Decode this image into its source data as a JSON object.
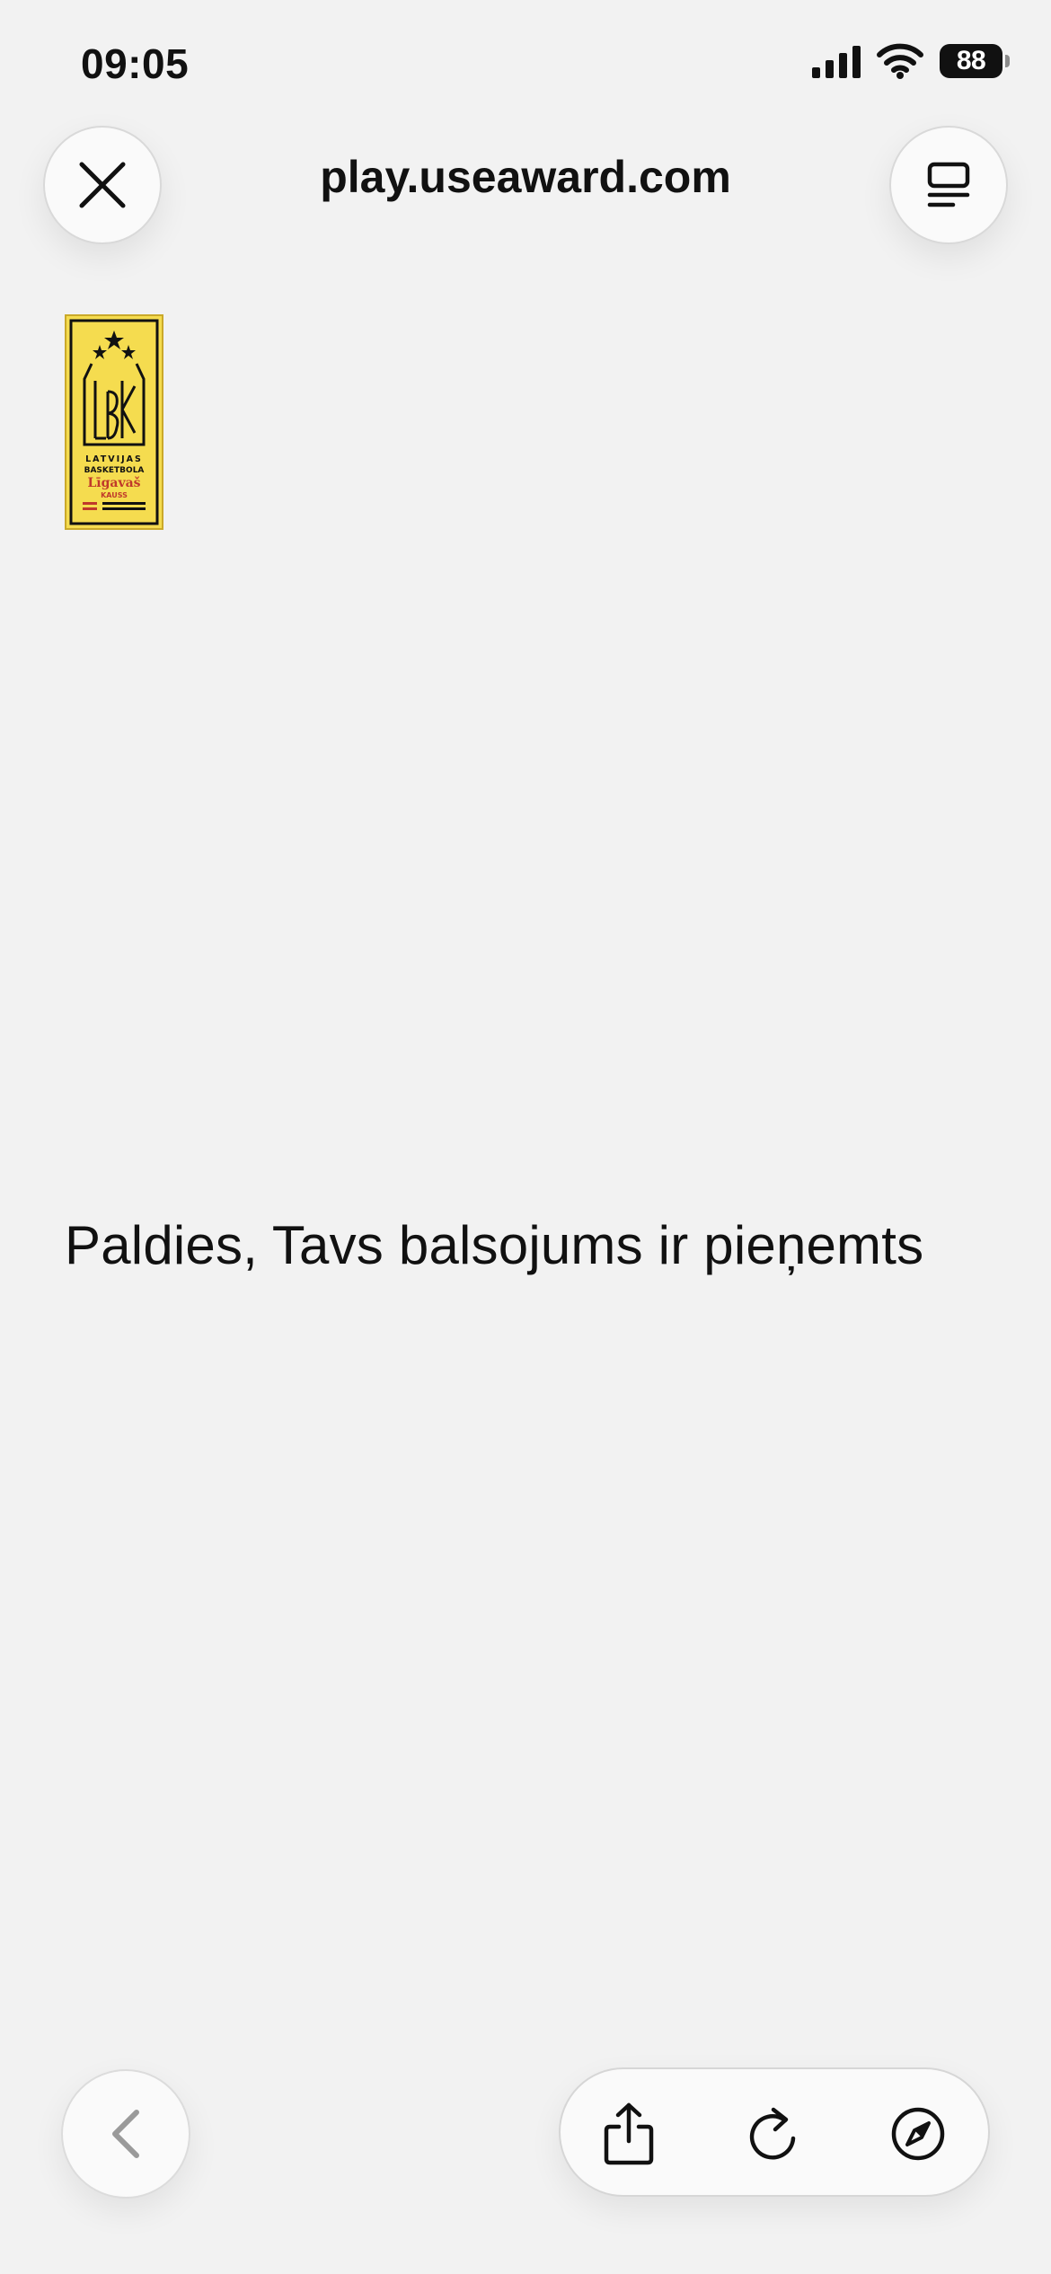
{
  "status_bar": {
    "time": "09:05",
    "battery": "88",
    "icons": [
      "signal-icon",
      "wifi-icon",
      "battery-icon"
    ]
  },
  "browser": {
    "url": "play.useaward.com",
    "close_icon": "close-icon",
    "reader_icon": "reader-mode-icon"
  },
  "logo": {
    "lines": [
      "LATVIJAS",
      "BASKETBOLA",
      "Līgavaš",
      "KAUSS"
    ],
    "colors": {
      "background": "#f5dc4f",
      "ink": "#111111",
      "accent": "#c0392b"
    }
  },
  "main": {
    "message": "Paldies, Tavs balsojums ir pieņemts"
  },
  "toolbar": {
    "back_icon": "chevron-left-icon",
    "share_icon": "share-icon",
    "reload_icon": "reload-icon",
    "compass_icon": "compass-icon"
  }
}
